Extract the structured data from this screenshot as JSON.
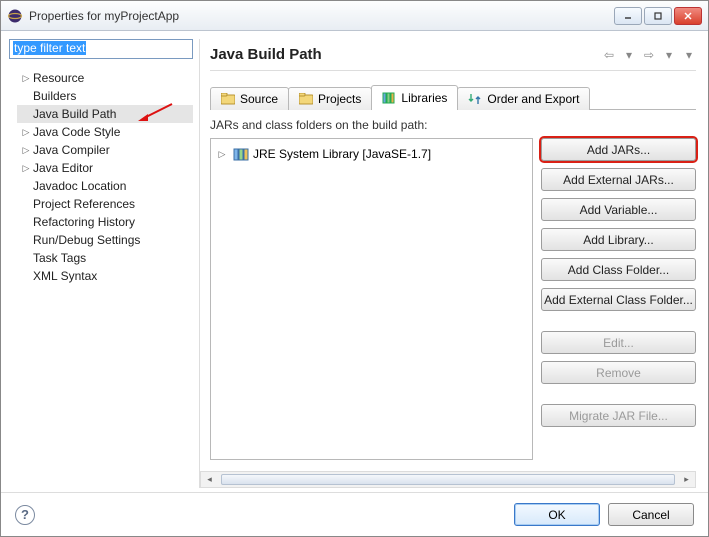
{
  "window": {
    "title": "Properties for myProjectApp"
  },
  "filter": {
    "placeholder": "type filter text"
  },
  "tree": {
    "items": [
      {
        "label": "Resource",
        "expandable": true
      },
      {
        "label": "Builders",
        "expandable": false
      },
      {
        "label": "Java Build Path",
        "expandable": false,
        "selected": true
      },
      {
        "label": "Java Code Style",
        "expandable": true
      },
      {
        "label": "Java Compiler",
        "expandable": true
      },
      {
        "label": "Java Editor",
        "expandable": true
      },
      {
        "label": "Javadoc Location",
        "expandable": false
      },
      {
        "label": "Project References",
        "expandable": false
      },
      {
        "label": "Refactoring History",
        "expandable": false
      },
      {
        "label": "Run/Debug Settings",
        "expandable": false
      },
      {
        "label": "Task Tags",
        "expandable": false
      },
      {
        "label": "XML Syntax",
        "expandable": false
      }
    ]
  },
  "page": {
    "title": "Java Build Path",
    "tabs": [
      {
        "label": "Source"
      },
      {
        "label": "Projects"
      },
      {
        "label": "Libraries",
        "active": true
      },
      {
        "label": "Order and Export"
      }
    ],
    "describe": "JARs and class folders on the build path:",
    "libs": [
      {
        "label": "JRE System Library [JavaSE-1.7]"
      }
    ],
    "buttons": {
      "addJars": "Add JARs...",
      "addExtJars": "Add External JARs...",
      "addVar": "Add Variable...",
      "addLib": "Add Library...",
      "addClassFolder": "Add Class Folder...",
      "addExtClassFolder": "Add External Class Folder...",
      "edit": "Edit...",
      "remove": "Remove",
      "migrate": "Migrate JAR File..."
    }
  },
  "dialog": {
    "ok": "OK",
    "cancel": "Cancel"
  }
}
